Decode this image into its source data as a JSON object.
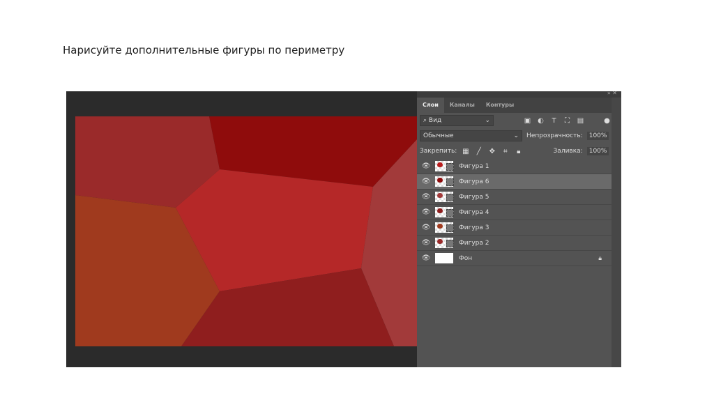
{
  "slide": {
    "title": "Нарисуйте дополнительные фигуры по периметру"
  },
  "panel": {
    "tabs": [
      "Слои",
      "Каналы",
      "Контуры"
    ],
    "filter_label": "Вид",
    "blend_mode": "Обычные",
    "opacity_label": "Непрозрачность:",
    "opacity_value": "100%",
    "lock_label": "Закрепить:",
    "fill_label": "Заливка:",
    "fill_value": "100%",
    "layers": [
      {
        "name": "Фигура 1",
        "color": "#b81d1d",
        "selected": false
      },
      {
        "name": "Фигура 6",
        "color": "#8f0c0c",
        "selected": true
      },
      {
        "name": "Фигура 5",
        "color": "#a23a3a",
        "selected": false
      },
      {
        "name": "Фигура 4",
        "color": "#8f1e1e",
        "selected": false
      },
      {
        "name": "Фигура 3",
        "color": "#a03a1e",
        "selected": false
      },
      {
        "name": "Фигура 2",
        "color": "#9a2a2a",
        "selected": false
      },
      {
        "name": "Фон",
        "color": "#ffffff",
        "selected": false,
        "locked": true
      }
    ]
  }
}
